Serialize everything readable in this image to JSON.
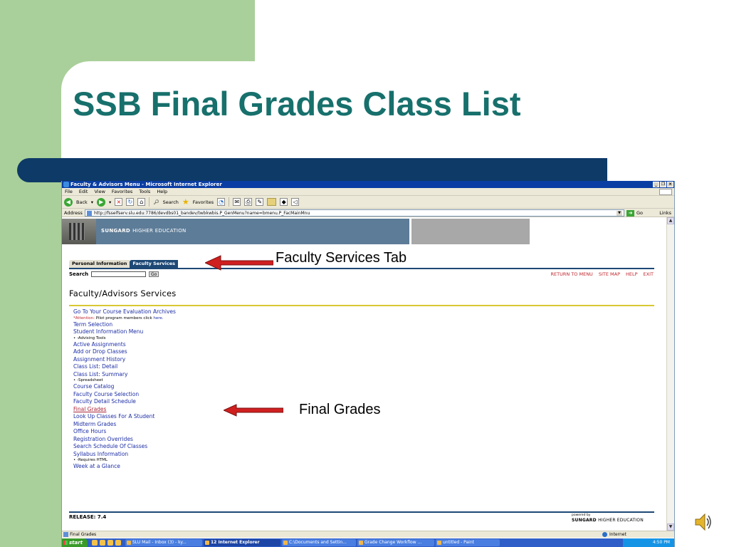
{
  "slide": {
    "title": "SSB Final Grades Class List",
    "annotations": {
      "faculty_services_tab": "Faculty Services Tab",
      "final_grades": "Final Grades"
    }
  },
  "browser": {
    "title": "Faculty & Advisors Menu - Microsoft Internet Explorer",
    "menu": [
      "File",
      "Edit",
      "View",
      "Favorites",
      "Tools",
      "Help"
    ],
    "toolbar": {
      "back": "Back",
      "search": "Search",
      "favorites": "Favorites"
    },
    "address_label": "Address",
    "address_url": "http://fsselfserv.slu.edu:7786/devdbs01_bandev/twbkwbis.P_GenMenu?name=bmenu.P_FacMainMnu",
    "go": "Go",
    "links": "Links",
    "status_text": "Final Grades",
    "status_zone": "Internet"
  },
  "page": {
    "banner_brand": "SUNGARD",
    "banner_sub": "HIGHER EDUCATION",
    "tabs": [
      {
        "label": "Personal Information",
        "active": false
      },
      {
        "label": "Faculty Services",
        "active": true
      }
    ],
    "search_label": "Search",
    "search_go": "Go",
    "top_links": [
      "RETURN TO MENU",
      "SITE MAP",
      "HELP",
      "EXIT"
    ],
    "section_title": "Faculty/Advisors Services",
    "menu_items": [
      {
        "label": "Go To Your Course Evaluation Archives"
      },
      {
        "attention": "*Attention:",
        "text": " Pilot program members click ",
        "link": "here."
      },
      {
        "label": "Term Selection"
      },
      {
        "label": "Student Information Menu"
      },
      {
        "note": "• -Advising Tools"
      },
      {
        "label": "Active Assignments"
      },
      {
        "label": "Add or Drop Classes"
      },
      {
        "label": "Assignment History"
      },
      {
        "label": "Class List: Detail"
      },
      {
        "label": "Class List: Summary"
      },
      {
        "note": "• -Spreadsheet"
      },
      {
        "label": "Course Catalog"
      },
      {
        "label": "Faculty Course Selection"
      },
      {
        "label": "Faculty Detail Schedule"
      },
      {
        "label": "Final Grades"
      },
      {
        "label": "Look Up Classes For A Student"
      },
      {
        "label": "Midterm Grades"
      },
      {
        "label": "Office Hours"
      },
      {
        "label": "Registration Overrides"
      },
      {
        "label": "Search Schedule Of Classes"
      },
      {
        "label": "Syllabus Information"
      },
      {
        "note": "• -Requires HTML"
      },
      {
        "label": "Week at a Glance"
      }
    ],
    "release": "RELEASE: 7.4",
    "powered_by": "powered by",
    "powered_brand": "SUNGARD",
    "powered_sub": "HIGHER EDUCATION"
  },
  "taskbar": {
    "start": "start",
    "tasks": [
      {
        "label": "SLU Mail - Inbox (3) - ky...",
        "active": false
      },
      {
        "label": "12 Internet Explorer",
        "active": true
      },
      {
        "label": "C:\\Documents and Settin...",
        "active": false
      },
      {
        "label": "Grade Change Workflow ...",
        "active": false
      },
      {
        "label": "untitled - Paint",
        "active": false
      }
    ],
    "clock": "4:50 PM"
  },
  "colors": {
    "title": "#17706c",
    "slide_green": "#a9d09a",
    "navy_bar": "#0e3a67",
    "link_blue": "#1d2fa5",
    "visited_red": "#a8273a",
    "arrow_red": "#d01f1f"
  }
}
